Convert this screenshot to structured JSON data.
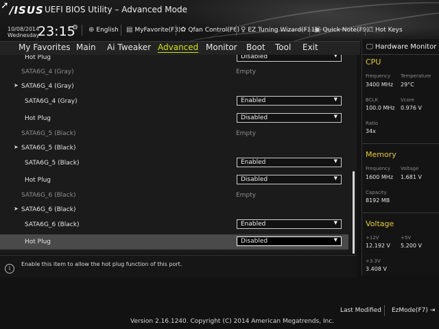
{
  "header": {
    "logo": "/ISUS",
    "title": "UEFI BIOS Utility – Advanced Mode",
    "date": "10/08/2014",
    "weekday": "Wednesday",
    "time": "23:15",
    "buttons": [
      {
        "label": "English",
        "icon": "globe-icon"
      },
      {
        "label": "MyFavorite(F3)",
        "icon": "favorite-icon"
      },
      {
        "label": "Qfan Control(F6)",
        "icon": "fan-icon"
      },
      {
        "label": "EZ Tuning Wizard(F11)",
        "icon": "bulb-icon"
      },
      {
        "label": "Quick Note(F9)",
        "icon": "note-icon"
      },
      {
        "label": "Hot Keys",
        "icon": "hotkeys-icon"
      }
    ]
  },
  "menu": {
    "items": [
      "My Favorites",
      "Main",
      "Ai Tweaker",
      "Advanced",
      "Monitor",
      "Boot",
      "Tool",
      "Exit"
    ],
    "active": "Advanced"
  },
  "settings": {
    "rows": [
      {
        "type": "opt",
        "label": "Hot Plug",
        "value": "Disabled"
      },
      {
        "type": "info",
        "label": "SATA6G_4 (Gray)",
        "value": "Empty"
      },
      {
        "type": "group",
        "label": "SATA6G_4 (Gray)"
      },
      {
        "type": "opt",
        "label": "SATA6G_4 (Gray)",
        "value": "Enabled"
      },
      {
        "type": "opt",
        "label": "Hot Plug",
        "value": "Disabled"
      },
      {
        "type": "info",
        "label": "SATA6G_5 (Black)",
        "value": "Empty"
      },
      {
        "type": "group",
        "label": "SATA6G_5 (Black)"
      },
      {
        "type": "opt",
        "label": "SATA6G_5 (Black)",
        "value": "Enabled"
      },
      {
        "type": "opt",
        "label": "Hot Plug",
        "value": "Disabled"
      },
      {
        "type": "info",
        "label": "SATA6G_6 (Black)",
        "value": "Empty"
      },
      {
        "type": "group",
        "label": "SATA6G_6 (Black)"
      },
      {
        "type": "opt",
        "label": "SATA6G_6 (Black)",
        "value": "Enabled"
      },
      {
        "type": "opt",
        "label": "Hot Plug",
        "value": "Disabled",
        "selected": true
      }
    ]
  },
  "help": {
    "text": "Enable this item to allow the hot plug function of this port."
  },
  "hw_monitor": {
    "title": "Hardware Monitor",
    "cpu": {
      "heading": "CPU",
      "frequency_label": "Frequency",
      "frequency": "3400 MHz",
      "temperature_label": "Temperature",
      "temperature": "29°C",
      "bclk_label": "BCLK",
      "bclk": "100.0 MHz",
      "vcore_label": "Vcore",
      "vcore": "0.976 V",
      "ratio_label": "Ratio",
      "ratio": "34x"
    },
    "memory": {
      "heading": "Memory",
      "frequency_label": "Frequency",
      "frequency": "1600 MHz",
      "voltage_label": "Voltage",
      "voltage": "1.681 V",
      "capacity_label": "Capacity",
      "capacity": "8192 MB"
    },
    "voltage": {
      "heading": "Voltage",
      "v12_label": "+12V",
      "v12": "12.192 V",
      "v5_label": "+5V",
      "v5": "5.200 V",
      "v33_label": "+3.3V",
      "v33": "3.408 V"
    }
  },
  "footer": {
    "version": "Version 2.16.1240. Copyright (C) 2014 American Megatrends, Inc.",
    "last_modified": "Last Modified",
    "ez_mode": "EzMode(F7)"
  }
}
